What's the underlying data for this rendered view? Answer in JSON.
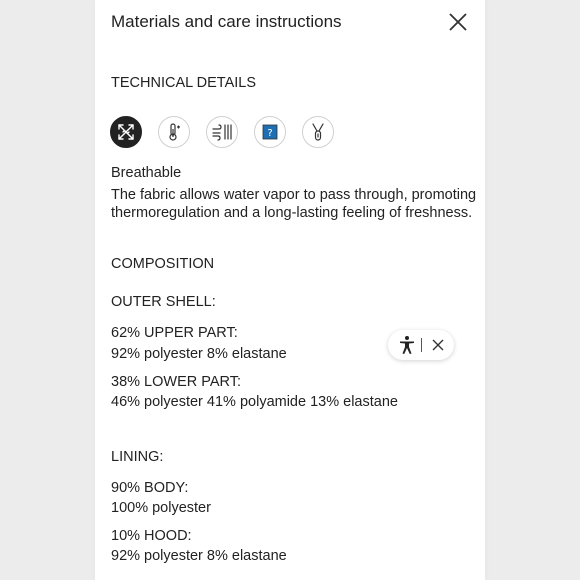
{
  "modal": {
    "title": "Materials and care instructions"
  },
  "technical": {
    "heading": "TECHNICAL DETAILS",
    "icons": [
      {
        "name": "breathable-icon",
        "selected": true
      },
      {
        "name": "thermometer-icon",
        "selected": false
      },
      {
        "name": "wind-icon",
        "selected": false
      },
      {
        "name": "waterproof-icon",
        "selected": false
      },
      {
        "name": "zipper-icon",
        "selected": false
      }
    ],
    "selected_title": "Breathable",
    "selected_description": "The fabric allows water vapor to pass through, promoting thermoregulation and a long-lasting feeling of freshness."
  },
  "composition": {
    "heading": "COMPOSITION",
    "outer_shell": {
      "heading": "OUTER SHELL:",
      "parts": [
        {
          "label": "62% UPPER PART:",
          "value": "92% polyester 8% elastane"
        },
        {
          "label": "38% LOWER PART:",
          "value": "46% polyester 41% polyamide 13% elastane"
        }
      ]
    },
    "lining": {
      "heading": "LINING:",
      "parts": [
        {
          "label": "90% BODY:",
          "value": "100% polyester"
        },
        {
          "label": "10% HOOD:",
          "value": "92% polyester 8% elastane"
        }
      ]
    }
  },
  "colors": {
    "panel_bg": "#ffffff",
    "page_bg": "#ececec",
    "text": "#222222",
    "icon_selected_bg": "#222222",
    "icon_blue": "#1f6fb5"
  }
}
